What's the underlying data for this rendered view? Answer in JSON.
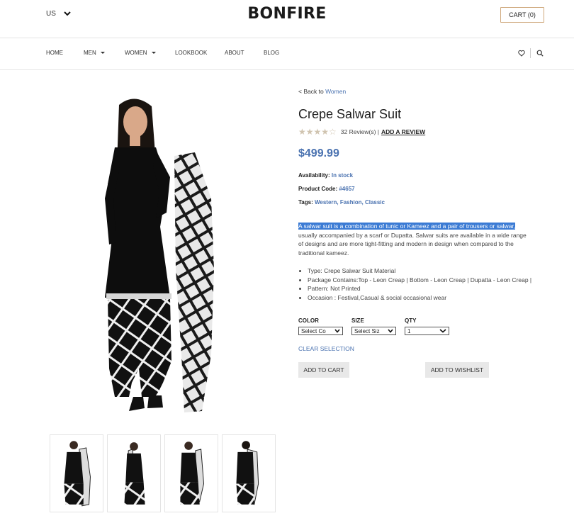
{
  "header": {
    "currency": "US",
    "brand": "BONFIRE",
    "cart_label": "CART (0)"
  },
  "nav": {
    "items": [
      {
        "label": "HOME",
        "dropdown": false
      },
      {
        "label": "MEN",
        "dropdown": true
      },
      {
        "label": "WOMEN",
        "dropdown": true
      },
      {
        "label": "LOOKBOOK",
        "dropdown": false
      },
      {
        "label": "ABOUT",
        "dropdown": false
      },
      {
        "label": "BLOG",
        "dropdown": false
      }
    ],
    "icons": [
      "heart-icon",
      "search-icon"
    ]
  },
  "product": {
    "back_prefix": "< Back to",
    "back_link": "Women",
    "title": "Crepe Salwar Suit",
    "rating_stars": 4,
    "reviews_text": "32 Review(s) |",
    "add_review": "ADD A REVIEW",
    "price": "$499.99",
    "availability_label": "Availability:",
    "availability_value": "In stock",
    "code_label": "Product Code:",
    "code_value": "#4657",
    "tags_label": "Tags:",
    "tags_value": "Western, Fashion, Classic",
    "desc_highlight": "A salwar suit is a combination of tunic or Kameez and a pair of trousers or salwar,",
    "desc_rest": "usually accompanied by a scarf or Dupatta. Salwar suits are available in a wide range of designs and are more tight-fitting and modern in design when compared to the traditional kameez.",
    "features": [
      "Type: Crepe Salwar Suit Material",
      "Package Contains:Top - Leon Creap | Bottom - Leon Creap | Dupatta - Leon Creap |",
      "Pattern: Not Printed",
      "Occasion : Festival,Casual & social occasional wear"
    ],
    "options": {
      "color_label": "COLOR",
      "color_value": "Select Co",
      "size_label": "SIZE",
      "size_value": "Select Siz",
      "qty_label": "QTY",
      "qty_value": "1"
    },
    "clear_selection": "CLEAR SELECTION",
    "add_to_cart": "ADD TO CART",
    "add_to_wishlist": "ADD TO WISHLIST"
  },
  "colors": {
    "accent": "#4a72b0",
    "highlight": "#3b7bd4",
    "cart_border": "#cfa97d"
  }
}
